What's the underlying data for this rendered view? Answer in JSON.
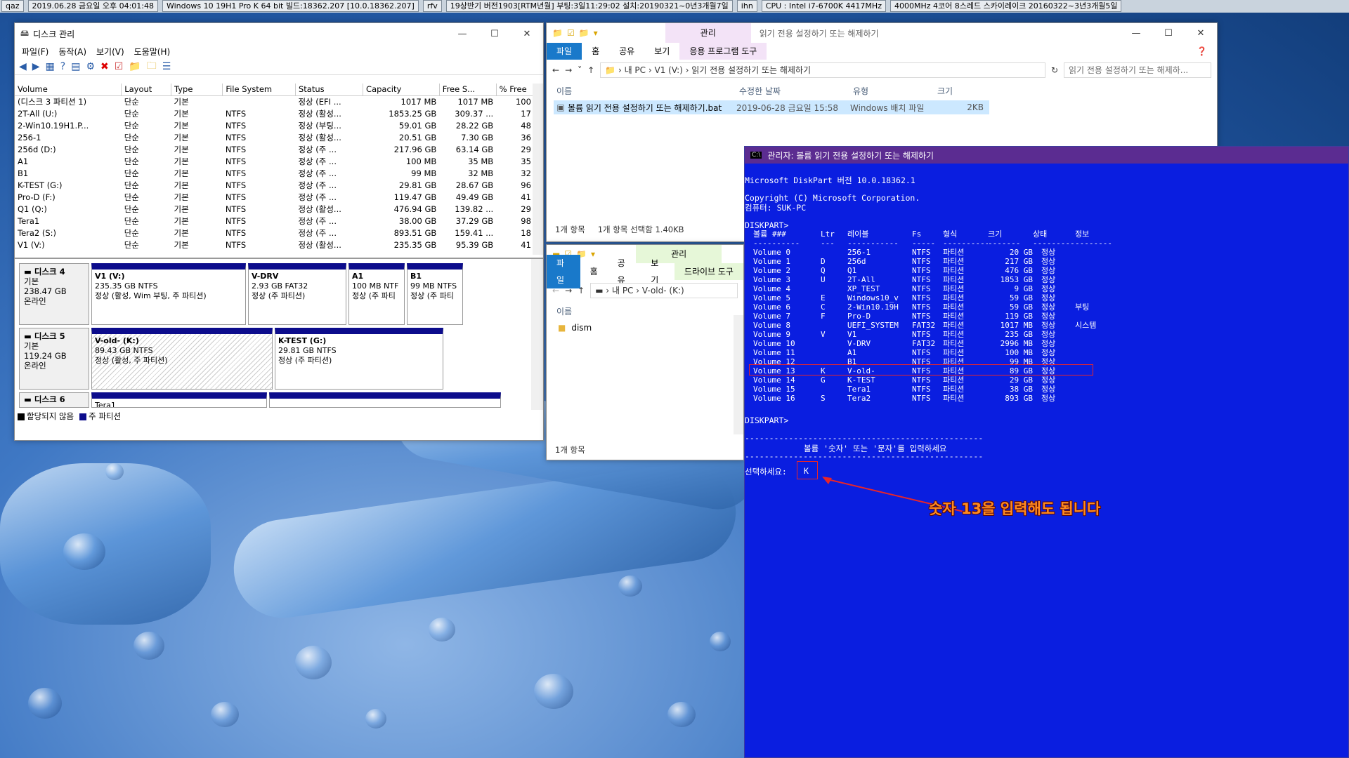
{
  "infobar": [
    "qaz",
    "2019.06.28 금요일 오후 04:01:48",
    "Windows 10 19H1 Pro K 64 bit 빌드:18362.207 [10.0.18362.207]",
    "rfv",
    "19상반기 버전1903[RTM년월] 부팅:3일11:29:02 설치:20190321~0년3개월7일",
    "ihn",
    "CPU : Intel i7-6700K 4417MHz",
    "4000MHz 4코어 8스레드 스카이레이크 20160322~3년3개월5일"
  ],
  "diskmgmt": {
    "title": "디스크 관리",
    "menu": [
      "파일(F)",
      "동작(A)",
      "보기(V)",
      "도움말(H)"
    ],
    "columns": [
      "Volume",
      "Layout",
      "Type",
      "File System",
      "Status",
      "Capacity",
      "Free S...",
      "% Free"
    ],
    "rows": [
      [
        "(디스크 3 파티션 1)",
        "단순",
        "기본",
        "",
        "정상 (EFI ...",
        "1017 MB",
        "1017 MB",
        "100 %"
      ],
      [
        "2T-All (U:)",
        "단순",
        "기본",
        "NTFS",
        "정상 (활성...",
        "1853.25 GB",
        "309.37 ...",
        "17 %"
      ],
      [
        "2-Win10.19H1.P...",
        "단순",
        "기본",
        "NTFS",
        "정상 (부팅...",
        "59.01 GB",
        "28.22 GB",
        "48 %"
      ],
      [
        "256-1",
        "단순",
        "기본",
        "NTFS",
        "정상 (활성...",
        "20.51 GB",
        "7.30 GB",
        "36 %"
      ],
      [
        "256d (D:)",
        "단순",
        "기본",
        "NTFS",
        "정상 (주 ...",
        "217.96 GB",
        "63.14 GB",
        "29 %"
      ],
      [
        "A1",
        "단순",
        "기본",
        "NTFS",
        "정상 (주 ...",
        "100 MB",
        "35 MB",
        "35 %"
      ],
      [
        "B1",
        "단순",
        "기본",
        "NTFS",
        "정상 (주 ...",
        "99 MB",
        "32 MB",
        "32 %"
      ],
      [
        "K-TEST (G:)",
        "단순",
        "기본",
        "NTFS",
        "정상 (주 ...",
        "29.81 GB",
        "28.67 GB",
        "96 %"
      ],
      [
        "Pro-D (F:)",
        "단순",
        "기본",
        "NTFS",
        "정상 (주 ...",
        "119.47 GB",
        "49.49 GB",
        "41 %"
      ],
      [
        "Q1 (Q:)",
        "단순",
        "기본",
        "NTFS",
        "정상 (활성...",
        "476.94 GB",
        "139.82 ...",
        "29 %"
      ],
      [
        "Tera1",
        "단순",
        "기본",
        "NTFS",
        "정상 (주 ...",
        "38.00 GB",
        "37.29 GB",
        "98 %"
      ],
      [
        "Tera2 (S:)",
        "단순",
        "기본",
        "NTFS",
        "정상 (주 ...",
        "893.51 GB",
        "159.41 ...",
        "18 %"
      ],
      [
        "V1 (V:)",
        "단순",
        "기본",
        "NTFS",
        "정상 (활성...",
        "235.35 GB",
        "95.39 GB",
        "41 %"
      ]
    ],
    "disk4": {
      "name": "디스크 4",
      "type": "기본",
      "size": "238.47 GB",
      "state": "온라인",
      "parts": [
        {
          "name": "V1  (V:)",
          "size": "235.35 GB NTFS",
          "status": "정상 (활성, Wim 부팅, 주 파티션)"
        },
        {
          "name": "V-DRV",
          "size": "2.93 GB FAT32",
          "status": "정상 (주 파티션)"
        },
        {
          "name": "A1",
          "size": "100 MB NTF",
          "status": "정상 (주 파티"
        },
        {
          "name": "B1",
          "size": "99 MB NTFS",
          "status": "정상 (주 파티"
        }
      ]
    },
    "disk5": {
      "name": "디스크 5",
      "type": "기본",
      "size": "119.24 GB",
      "state": "온라인",
      "parts": [
        {
          "name": "V-old-  (K:)",
          "size": "89.43 GB NTFS",
          "status": "정상 (활성, 주 파티션)"
        },
        {
          "name": "K-TEST  (G:)",
          "size": "29.81 GB NTFS",
          "status": "정상 (주 파티션)"
        }
      ]
    },
    "disk6": {
      "name": "디스크 6",
      "type": "기본",
      "part_hint": "Tera1"
    },
    "legend": [
      "할당되지 않음",
      "주 파티션"
    ]
  },
  "explorer1": {
    "context_label": "관리",
    "title": "읽기 전용 설정하기 또는 해제하기",
    "tabs": [
      "파일",
      "홈",
      "공유",
      "보기",
      "응용 프로그램 도구"
    ],
    "address": [
      "내 PC",
      "V1 (V:)",
      "읽기 전용 설정하기 또는 해제하기"
    ],
    "search": "읽기 전용 설정하기 또는 해제하...",
    "columns": [
      "이름",
      "수정한 날짜",
      "유형",
      "크기"
    ],
    "file": {
      "name": "볼륨 읽기 전용 설정하기 또는 해제하기.bat",
      "date": "2019-06-28 금요일 15:58",
      "type": "Windows 배치 파일",
      "size": "2KB"
    },
    "status": [
      "1개 항목",
      "1개 항목 선택함 1.40KB"
    ]
  },
  "explorer2": {
    "context_label": "관리",
    "tabs": [
      "파일",
      "홈",
      "공유",
      "보기",
      "드라이브 도구"
    ],
    "address": [
      "내 PC",
      "V-old- (K:)"
    ],
    "column": "이름",
    "folder": "dism",
    "status": "1개 항목"
  },
  "console": {
    "title": "관리자:  볼륨 읽기 전용 설정하기 또는 해제하기",
    "line1": "Microsoft DiskPart 버전 10.0.18362.1",
    "line2": "Copyright (C) Microsoft Corporation.",
    "line3": "컴퓨터: SUK-PC",
    "prompt1": "DISKPART>",
    "header": [
      "볼륨 ###",
      "Ltr",
      "레이블",
      "Fs",
      "형식",
      "크기",
      "상태",
      "정보"
    ],
    "sep": [
      "----------",
      "---",
      "-----------",
      "-----",
      "----------",
      "-------",
      "---------",
      "--------"
    ],
    "volumes": [
      [
        "Volume 0",
        "",
        "256-1",
        "NTFS",
        "파티션",
        "20 GB",
        "정상",
        ""
      ],
      [
        "Volume 1",
        "D",
        "256d",
        "NTFS",
        "파티션",
        "217 GB",
        "정상",
        ""
      ],
      [
        "Volume 2",
        "Q",
        "Q1",
        "NTFS",
        "파티션",
        "476 GB",
        "정상",
        ""
      ],
      [
        "Volume 3",
        "U",
        "2T-All",
        "NTFS",
        "파티션",
        "1853 GB",
        "정상",
        ""
      ],
      [
        "Volume 4",
        "",
        "XP_TEST",
        "NTFS",
        "파티션",
        "9 GB",
        "정상",
        ""
      ],
      [
        "Volume 5",
        "E",
        "Windows10_v",
        "NTFS",
        "파티션",
        "59 GB",
        "정상",
        ""
      ],
      [
        "Volume 6",
        "C",
        "2-Win10.19H",
        "NTFS",
        "파티션",
        "59 GB",
        "정상",
        "부팅"
      ],
      [
        "Volume 7",
        "F",
        "Pro-D",
        "NTFS",
        "파티션",
        "119 GB",
        "정상",
        ""
      ],
      [
        "Volume 8",
        "",
        "UEFI_SYSTEM",
        "FAT32",
        "파티션",
        "1017 MB",
        "정상",
        "시스템"
      ],
      [
        "Volume 9",
        "V",
        "V1",
        "NTFS",
        "파티션",
        "235 GB",
        "정상",
        ""
      ],
      [
        "Volume 10",
        "",
        "V-DRV",
        "FAT32",
        "파티션",
        "2996 MB",
        "정상",
        ""
      ],
      [
        "Volume 11",
        "",
        "A1",
        "NTFS",
        "파티션",
        "100 MB",
        "정상",
        ""
      ],
      [
        "Volume 12",
        "",
        "B1",
        "NTFS",
        "파티션",
        "99 MB",
        "정상",
        ""
      ],
      [
        "Volume 13",
        "K",
        "V-old-",
        "NTFS",
        "파티션",
        "89 GB",
        "정상",
        ""
      ],
      [
        "Volume 14",
        "G",
        "K-TEST",
        "NTFS",
        "파티션",
        "29 GB",
        "정상",
        ""
      ],
      [
        "Volume 15",
        "",
        "Tera1",
        "NTFS",
        "파티션",
        "38 GB",
        "정상",
        ""
      ],
      [
        "Volume 16",
        "S",
        "Tera2",
        "NTFS",
        "파티션",
        "893 GB",
        "정상",
        ""
      ]
    ],
    "prompt2": "DISKPART>",
    "dashes": "-------------------------------------------------",
    "instruction": "볼륨 '숫자' 또는 '문자'를 입력하세요",
    "select_label": "선택하세요:",
    "select_value": "K",
    "highlight_color": "#e8252a"
  },
  "annotation": "숫자 13을 입력해도 됩니다",
  "colors": {
    "accent": "#1979ca",
    "console_bg": "#0a1ee0",
    "console_title": "#5b2c91",
    "partition_bar": "#0c0c8c",
    "annotation": "#ff8a1f"
  }
}
